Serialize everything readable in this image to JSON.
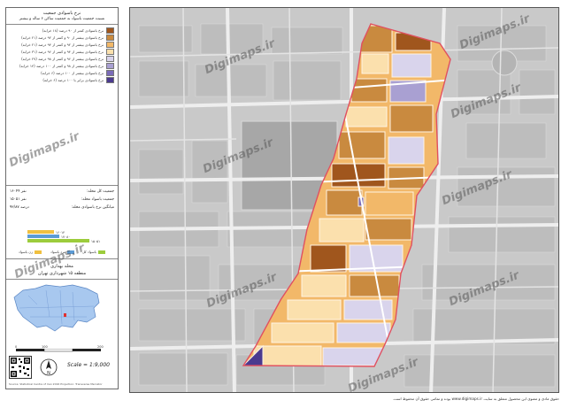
{
  "legend": {
    "title_line1": "نرخ باسوادی جمعیت",
    "title_line2": "نسبت جمعیت باسواد به جمعیت ساکن ۶ ساله و بیشتر",
    "items": [
      {
        "label": "نرخ باسوادی کمتر از ۹۰ درصد (۱۸ خرابه)",
        "color": "#a0561d"
      },
      {
        "label": "نرخ باسوادی بیشتر از ۹۰ و کمتر از ۹۲ درصد (۲۱ خرابه)",
        "color": "#c98a3f"
      },
      {
        "label": "نرخ باسوادی بیشتر از ۹۲ و کمتر از ۹۴ درصد (۲۱ خرابه)",
        "color": "#f2b869"
      },
      {
        "label": "نرخ باسوادی بیشتر از ۹۴ و کمتر از ۹۶ درصد (۳۱ خرابه)",
        "color": "#fbe0ad"
      },
      {
        "label": "نرخ باسوادی بیشتر از ۹۶ و کمتر از ۹۸ درصد (۲۷ خرابه)",
        "color": "#d9d4ec"
      },
      {
        "label": "نرخ باسوادی بیشتر از ۹۸ و کمتر از ۱۰۰ درصد (۱۴ خرابه)",
        "color": "#a9a0d2"
      },
      {
        "label": "نرخ باسوادی بیشتر از ۱۰۰ درصد (۶ خرابه)",
        "color": "#7a6bb8"
      },
      {
        "label": "نرخ باسوادی برابر با ۱۰۰ درصد (۶ خرابه)",
        "color": "#4b3a8f"
      }
    ]
  },
  "stats": [
    {
      "label": "جمعیت کل محله:",
      "value": "۱۶۰۴۴ نفر"
    },
    {
      "label": "جمعیت باسواد محله:",
      "value": "۱۵۰۵۱ نفر"
    },
    {
      "label": "میانگین نرخ باسوادی محله:",
      "value": "۹۳/۸۷ درصد"
    }
  ],
  "bar_chart": {
    "labels": [
      "۱۶۰۱۴",
      "۱۷۰۸۰",
      "۱۵۰۵۱"
    ],
    "colors": [
      "#f0c040",
      "#5b9bd5",
      "#9ccc3c"
    ],
    "categories": [
      {
        "label": "باسواد کل",
        "color": "#9ccc3c"
      },
      {
        "label": "مرد باسواد",
        "color": "#5b9bd5"
      },
      {
        "label": "زن باسواد",
        "color": "#f0c040"
      }
    ]
  },
  "region": {
    "line1": "محله بهداری",
    "line2": "منطقه ۱۵ شهرداری تهران"
  },
  "scale": {
    "text": "Scale = 1:9,000",
    "ticks": [
      "0",
      "100",
      "200"
    ]
  },
  "credit_small": "Source: Statistical Centre of Iran 2016 Projection: Transverse Mercator",
  "watermark": "Digimaps.ir",
  "footer": "حقوق مادی و معنوی این محصول متعلق به سایت www.digimaps.ir بوده و تمامی حقوق آن محفوظ است.",
  "colors": {
    "map_bg": "#c8c8c8",
    "road": "#ececec",
    "boundary": "#e05060"
  }
}
